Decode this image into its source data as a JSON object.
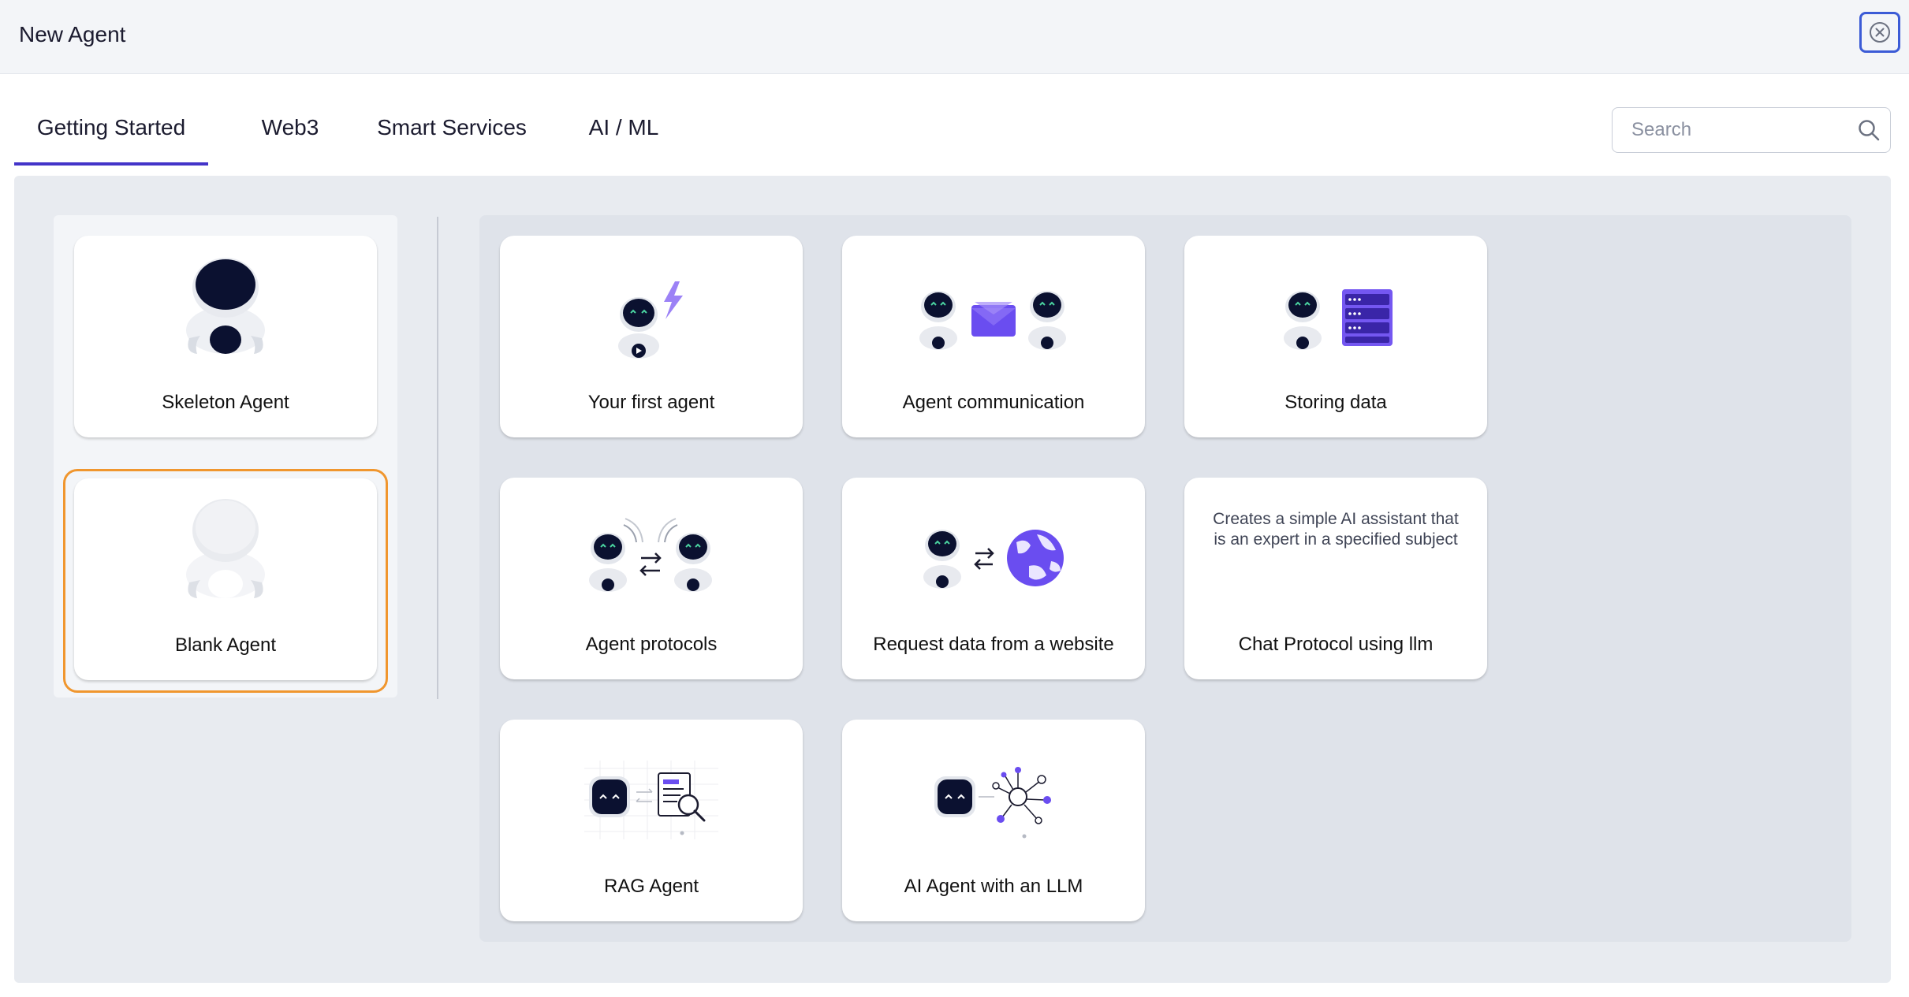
{
  "header": {
    "title": "New Agent"
  },
  "tabs": [
    {
      "label": "Getting Started",
      "active": true
    },
    {
      "label": "Web3",
      "active": false
    },
    {
      "label": "Smart Services",
      "active": false
    },
    {
      "label": "AI / ML",
      "active": false
    }
  ],
  "search": {
    "placeholder": "Search",
    "value": ""
  },
  "left_cards": [
    {
      "label": "Skeleton Agent",
      "icon": "skeleton-robot-icon",
      "selected": false
    },
    {
      "label": "Blank Agent",
      "icon": "blank-robot-icon",
      "selected": true
    }
  ],
  "right_cards": [
    {
      "label": "Your first agent",
      "icon": "robot-lightning-icon"
    },
    {
      "label": "Agent communication",
      "icon": "robots-envelope-icon"
    },
    {
      "label": "Storing data",
      "icon": "robot-database-icon"
    },
    {
      "label": "Agent protocols",
      "icon": "robots-exchange-icon"
    },
    {
      "label": "Request data from a website",
      "icon": "robot-globe-icon"
    },
    {
      "label": "Chat Protocol using llm",
      "description": "Creates a simple AI assistant that is an expert in a specified subject"
    },
    {
      "label": "RAG Agent",
      "icon": "robot-document-search-icon"
    },
    {
      "label": "AI Agent with an LLM",
      "icon": "robot-network-icon"
    }
  ],
  "colors": {
    "accent": "#4334c9",
    "selected": "#f0962e",
    "close": "#3b5bd6",
    "robot_dark": "#0b1130",
    "purple": "#6a4df0"
  }
}
